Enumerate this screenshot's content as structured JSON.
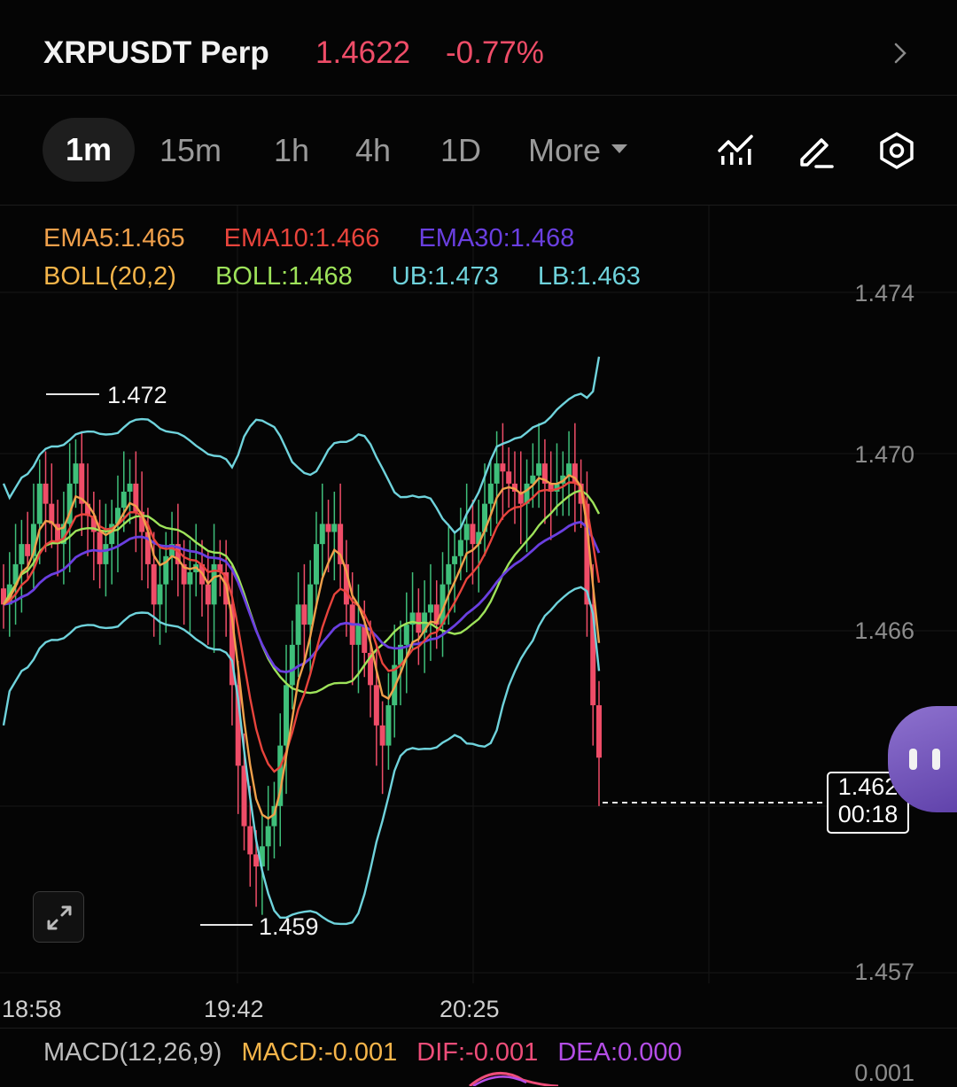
{
  "header": {
    "symbol": "XRPUSDT Perp",
    "price": "1.4622",
    "change": "-0.77%",
    "icons": [
      "chevron-right-icon"
    ]
  },
  "toolbar": {
    "timeframes": [
      "1m",
      "15m",
      "1h",
      "4h",
      "1D"
    ],
    "active_timeframe": "1m",
    "more_label": "More",
    "icons": [
      "indicators-icon",
      "draw-pen-icon",
      "settings-hex-icon"
    ]
  },
  "indicators": {
    "ema5": "EMA5:1.465",
    "ema10": "EMA10:1.466",
    "ema30": "EMA30:1.468",
    "boll_params": "BOLL(20,2)",
    "boll": "BOLL:1.468",
    "ub": "UB:1.473",
    "lb": "LB:1.463"
  },
  "colors": {
    "up": "#3fbf7a",
    "down": "#ef4d68",
    "ema5": "#f0a04b",
    "ema10": "#e8443c",
    "ema30": "#6a3fe0",
    "boll_mid": "#9ee35a",
    "boll_band": "#6fd3dc",
    "boll_params": "#f5b54a",
    "macd": "#f5b54a",
    "dif": "#ee4d79",
    "dea": "#b44ee6"
  },
  "y_axis": [
    "1.474",
    "1.470",
    "1.466",
    "1.457"
  ],
  "x_axis": [
    "18:58",
    "19:42",
    "20:25"
  ],
  "annotations": {
    "high": "1.472",
    "low": "1.459"
  },
  "last_price": {
    "value": "1.462",
    "countdown": "00:18"
  },
  "macd": {
    "params": "MACD(12,26,9)",
    "macd": "MACD:-0.001",
    "dif": "DIF:-0.001",
    "dea": "DEA:0.000",
    "y_label": "0.001"
  },
  "chart_data": {
    "type": "candlestick",
    "y_range": [
      1.4566,
      1.4759
    ],
    "x_ticks": [
      "18:58",
      "19:42",
      "20:25"
    ],
    "candles_close": [
      1.466,
      1.4665,
      1.467,
      1.4675,
      1.4672,
      1.468,
      1.469,
      1.4685,
      1.468,
      1.4675,
      1.468,
      1.469,
      1.4695,
      1.4685,
      1.4682,
      1.4678,
      1.467,
      1.4675,
      1.468,
      1.4684,
      1.4688,
      1.469,
      1.4683,
      1.4678,
      1.467,
      1.466,
      1.4665,
      1.4672,
      1.4675,
      1.467,
      1.4665,
      1.4668,
      1.467,
      1.4665,
      1.466,
      1.467,
      1.4668,
      1.466,
      1.464,
      1.462,
      1.4605,
      1.4598,
      1.4595,
      1.46,
      1.4605,
      1.461,
      1.4625,
      1.464,
      1.465,
      1.466,
      1.4655,
      1.4665,
      1.4675,
      1.468,
      1.4678,
      1.468,
      1.467,
      1.466,
      1.465,
      1.4655,
      1.4648,
      1.464,
      1.463,
      1.4625,
      1.4635,
      1.4645,
      1.465,
      1.4655,
      1.4658,
      1.4653,
      1.4658,
      1.466,
      1.4655,
      1.4665,
      1.467,
      1.4672,
      1.4676,
      1.468,
      1.4675,
      1.4678,
      1.4685,
      1.469,
      1.4695,
      1.4693,
      1.469,
      1.4688,
      1.4685,
      1.469,
      1.4692,
      1.4695,
      1.469,
      1.4688,
      1.469,
      1.4692,
      1.4695,
      1.469,
      1.4685,
      1.466,
      1.4635,
      1.4622
    ],
    "ema5_last": 1.465,
    "ema10_last": 1.466,
    "ema30_last": 1.468,
    "boll_last": 1.468,
    "ub_last": 1.473,
    "lb_last": 1.463
  }
}
